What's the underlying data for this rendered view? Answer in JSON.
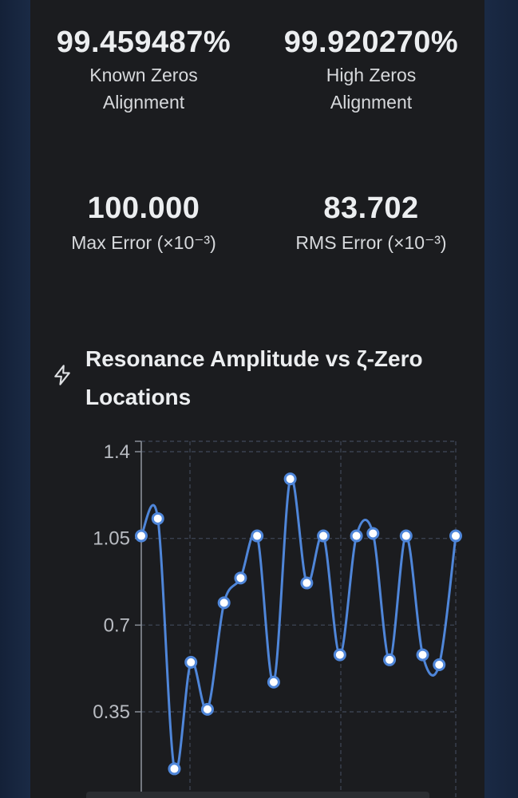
{
  "stats": [
    {
      "value": "99.459487%",
      "label": "Known Zeros Alignment"
    },
    {
      "value": "99.920270%",
      "label": "High Zeros Alignment"
    },
    {
      "value": "100.000",
      "label": "Max Error (×10⁻³)"
    },
    {
      "value": "83.702",
      "label": "RMS Error (×10⁻³)"
    }
  ],
  "chart_header": {
    "icon": "lightning-bolt-icon",
    "title": "Resonance Amplitude vs ζ-Zero Locations"
  },
  "chart_data": {
    "type": "line",
    "title": "Resonance Amplitude vs ζ-Zero Locations",
    "xlabel": "",
    "ylabel": "",
    "y_ticks": [
      "1.4",
      "1.05",
      "0.7",
      "0.35"
    ],
    "ylim_visible": [
      0.1,
      1.4
    ],
    "grid": true,
    "line_color": "#4f86d9",
    "marker_fill": "#ffffff",
    "series": [
      {
        "values": [
          1.06,
          1.13,
          0.12,
          0.55,
          0.36,
          0.79,
          0.89,
          1.06,
          0.47,
          1.29,
          0.87,
          1.06,
          0.58,
          1.06,
          1.07,
          0.56,
          1.06,
          0.58,
          0.54,
          1.06
        ]
      }
    ]
  },
  "colors": {
    "panel_bg": "#1b1c1f",
    "text": "#eceef0",
    "accent_line": "#4f86d9"
  }
}
